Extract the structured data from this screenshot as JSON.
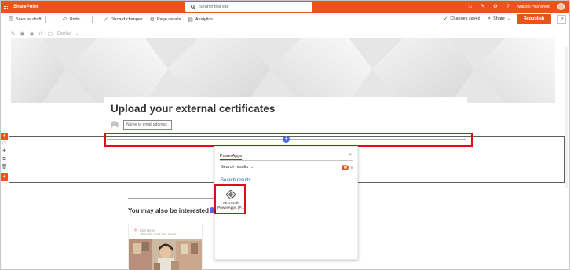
{
  "suite_bar": {
    "brand": "SharePoint",
    "search_placeholder": "Search this site",
    "user_name": "Makoto Hashimoto",
    "icons": [
      "waffle-icon",
      "search-icon",
      "chat-icon",
      "megaphone-icon",
      "gear-icon",
      "help-icon"
    ]
  },
  "command_bar": {
    "save_as_draft": "Save as draft",
    "undo": "Undo",
    "discard_changes": "Discard changes",
    "page_details": "Page details",
    "analytics": "Analytics",
    "changes_saved": "Changes saved",
    "share": "Share",
    "republish": "Republish"
  },
  "edit_toolbar": {
    "overlay_label": "Overlay"
  },
  "page": {
    "title": "Upload your external certificates",
    "author_placeholder": "Name or email address"
  },
  "toolbox": {
    "search_value": "PowerApps",
    "filter_label": "Search results",
    "results_heading": "Search results",
    "items": [
      {
        "label_line1": "Microsoft",
        "label_line2": "PowerApps (P...",
        "icon": "powerapps-icon"
      }
    ]
  },
  "related": {
    "heading": "You may also be interested in",
    "card": {
      "line1": "Edit News",
      "line2": "People read this news"
    }
  },
  "colors": {
    "accent": "#e8541b",
    "highlight": "#e00b1c",
    "link": "#1b5fa8",
    "section_add": "#4f6bed"
  }
}
